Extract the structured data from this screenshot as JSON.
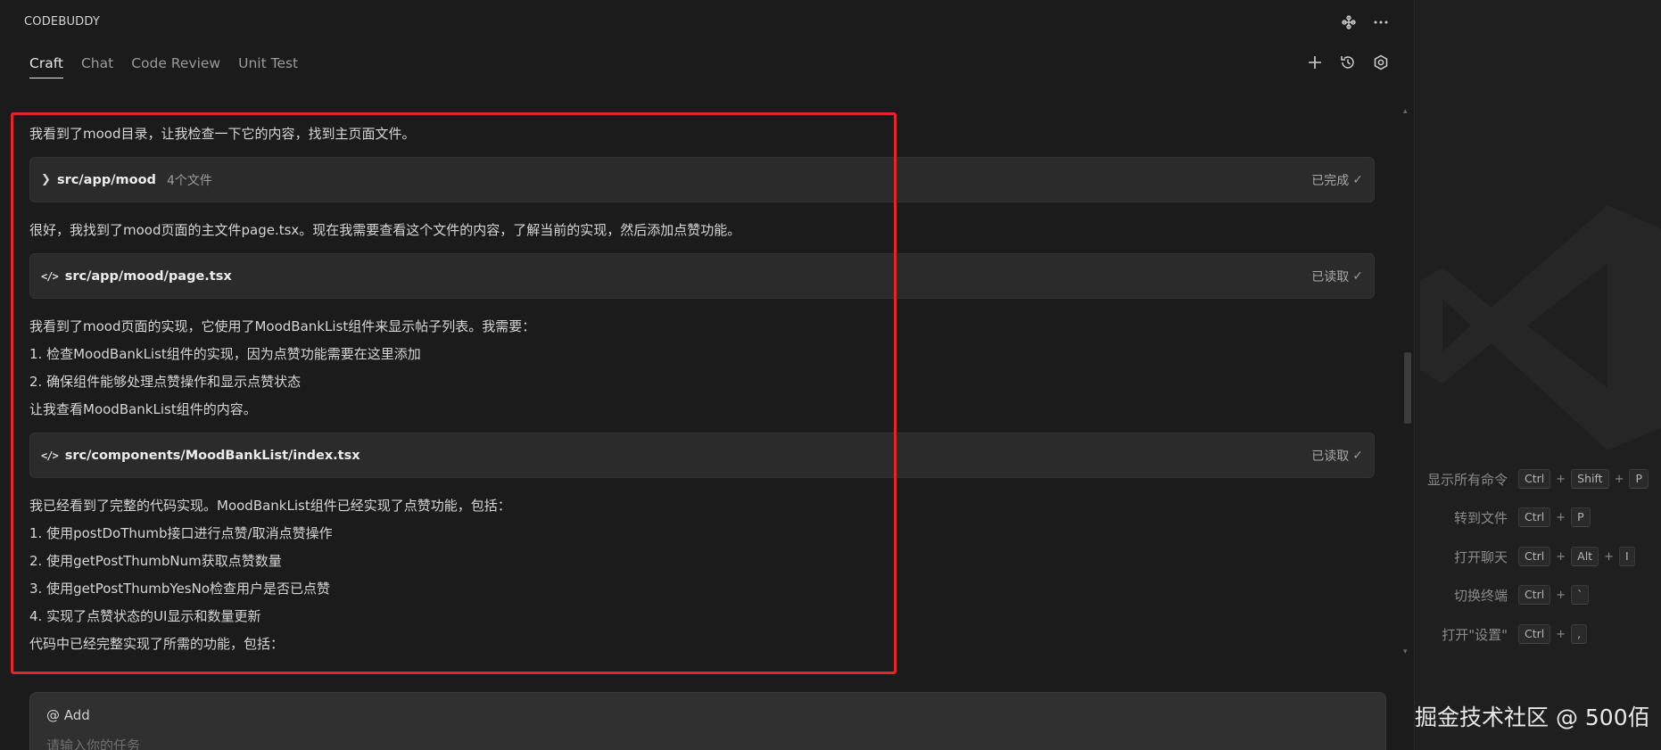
{
  "app": {
    "brand": "CODEBUDDY"
  },
  "tabs": [
    {
      "label": "Craft",
      "active": true
    },
    {
      "label": "Chat",
      "active": false
    },
    {
      "label": "Code Review",
      "active": false
    },
    {
      "label": "Unit Test",
      "active": false
    }
  ],
  "icons": {
    "top": [
      "sparkle-icon",
      "more-icon"
    ],
    "toolbar": [
      "plus-icon",
      "history-icon",
      "settings-icon"
    ]
  },
  "conversation": {
    "p1": "我看到了mood目录，让我检查一下它的内容，找到主页面文件。",
    "card1": {
      "path": "src/app/mood",
      "meta": "4个文件",
      "status": "已完成"
    },
    "p2": "很好，我找到了mood页面的主文件page.tsx。现在我需要查看这个文件的内容，了解当前的实现，然后添加点赞功能。",
    "card2": {
      "path": "src/app/mood/page.tsx",
      "status": "已读取"
    },
    "p3": [
      "我看到了mood页面的实现，它使用了MoodBankList组件来显示帖子列表。我需要：",
      "1. 检查MoodBankList组件的实现，因为点赞功能需要在这里添加",
      "2. 确保组件能够处理点赞操作和显示点赞状态",
      "让我查看MoodBankList组件的内容。"
    ],
    "card3": {
      "path": "src/components/MoodBankList/index.tsx",
      "status": "已读取"
    },
    "p4": [
      "我已经看到了完整的代码实现。MoodBankList组件已经实现了点赞功能，包括：",
      "1. 使用postDoThumb接口进行点赞/取消点赞操作",
      "2. 使用getPostThumbNum获取点赞数量",
      "3. 使用getPostThumbYesNo检查用户是否已点赞",
      "4. 实现了点赞状态的UI显示和数量更新",
      "代码中已经完整实现了所需的功能，包括："
    ]
  },
  "input": {
    "add_label": "@ Add",
    "placeholder": "请输入你的任务"
  },
  "shortcuts": [
    {
      "label": "显示所有命令",
      "keys": [
        "Ctrl",
        "Shift",
        "P"
      ]
    },
    {
      "label": "转到文件",
      "keys": [
        "Ctrl",
        "P"
      ]
    },
    {
      "label": "打开聊天",
      "keys": [
        "Ctrl",
        "Alt",
        "I"
      ]
    },
    {
      "label": "切换终端",
      "keys": [
        "Ctrl",
        "`"
      ]
    },
    {
      "label": "打开\"设置\"",
      "keys": [
        "Ctrl",
        ","
      ]
    }
  ],
  "watermark": "掘金技术社区 @ 500佰",
  "colors": {
    "highlight_border": "#e3262a",
    "panel_bg": "#1b1b1b",
    "card_bg": "#2b2b2b"
  }
}
